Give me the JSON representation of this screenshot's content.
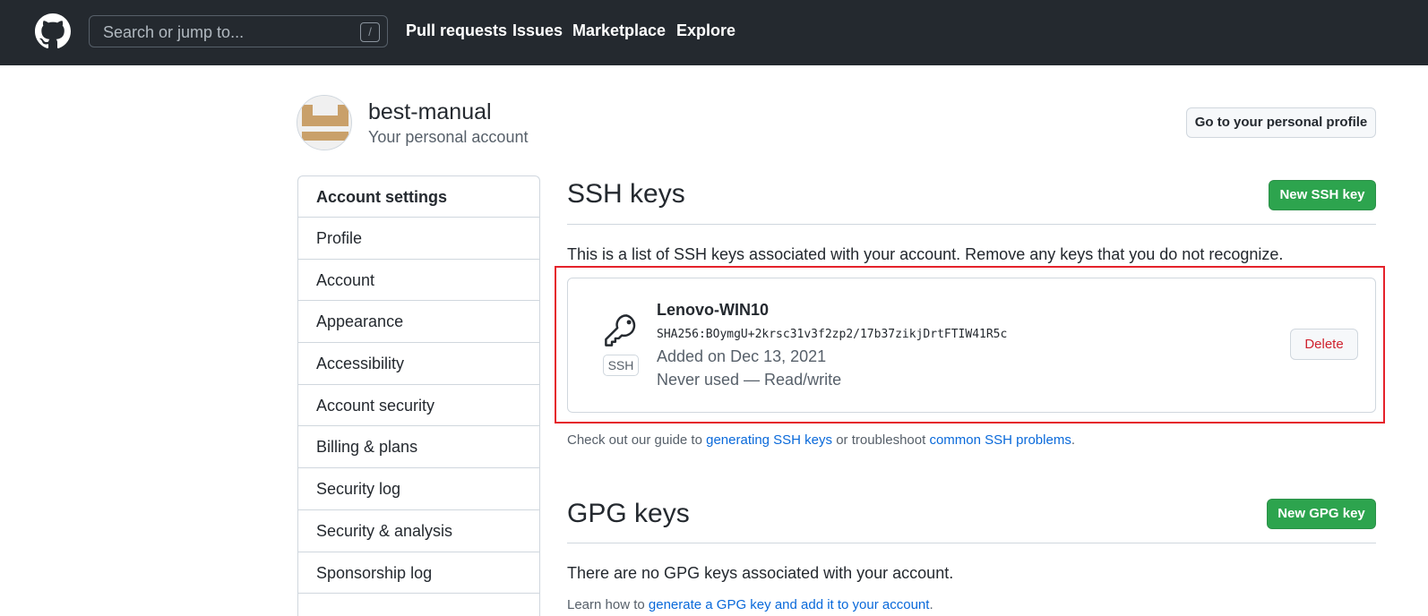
{
  "header": {
    "search_placeholder": "Search or jump to...",
    "search_shortcut": "/",
    "nav": [
      "Pull requests",
      "Issues",
      "Marketplace",
      "Explore"
    ],
    "background_color": "#24292f"
  },
  "profile": {
    "username": "best-manual",
    "account_type": "Your personal account",
    "profile_button": "Go to your personal profile"
  },
  "sidebar": {
    "heading": "Account settings",
    "items": [
      "Profile",
      "Account",
      "Appearance",
      "Accessibility",
      "Account security",
      "Billing & plans",
      "Security log",
      "Security & analysis",
      "Sponsorship log"
    ]
  },
  "ssh": {
    "title": "SSH keys",
    "new_button": "New SSH key",
    "description": "This is a list of SSH keys associated with your account. Remove any keys that you do not recognize.",
    "key": {
      "badge": "SSH",
      "name": "Lenovo-WIN10",
      "fingerprint": "SHA256:BOymgU+2krsc31v3f2zp2/17b37zikjDrtFTIW41R5c",
      "added": "Added on Dec 13, 2021",
      "usage": "Never used — Read/write",
      "delete_button": "Delete"
    },
    "guide": {
      "prefix": "Check out our guide to ",
      "link1": "generating SSH keys",
      "middle": " or troubleshoot ",
      "link2": "common SSH problems",
      "suffix": "."
    }
  },
  "gpg": {
    "title": "GPG keys",
    "new_button": "New GPG key",
    "empty_text": "There are no GPG keys associated with your account.",
    "learn_prefix": "Learn how to ",
    "learn_link": "generate a GPG key and add it to your account",
    "learn_suffix": "."
  },
  "colors": {
    "primary_green": "#2da44e",
    "link_blue": "#0969da",
    "danger_red": "#cf222e",
    "highlight_red": "#e5222b"
  }
}
